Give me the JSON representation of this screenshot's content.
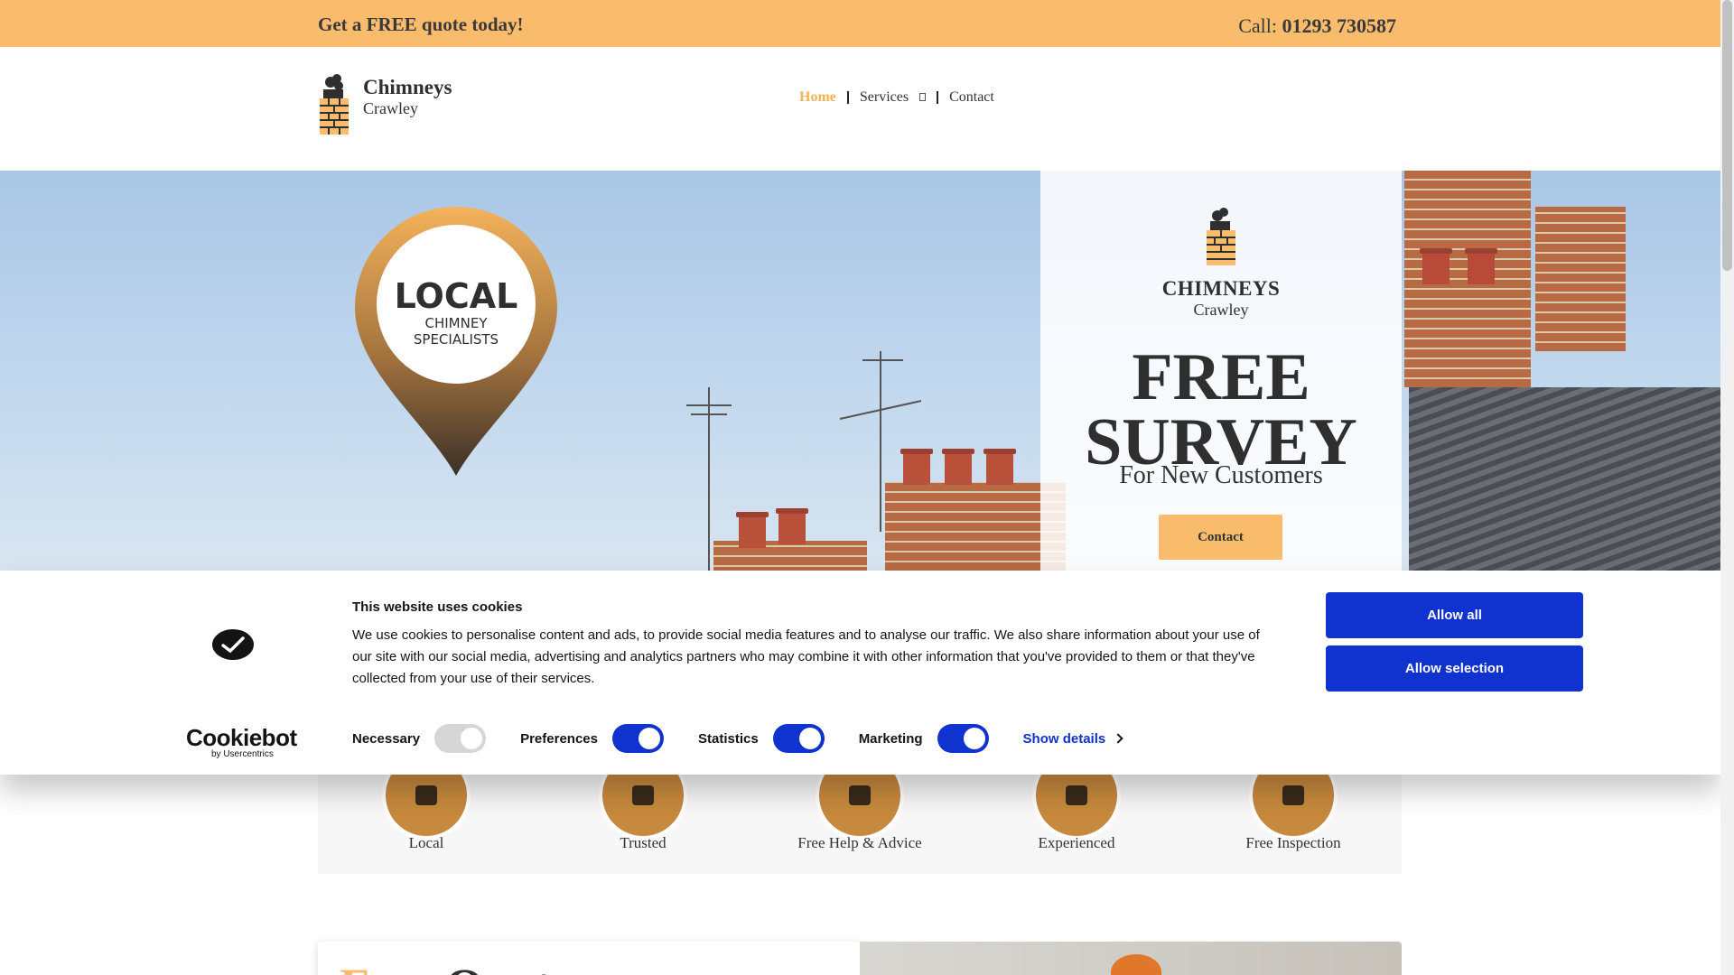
{
  "topbar": {
    "quote": "Get a FREE quote today!",
    "call_label": "Call:",
    "phone": "01293 730587"
  },
  "brand": {
    "name": "Chimneys",
    "town": "Crawley"
  },
  "nav": {
    "items": [
      {
        "label": "Home",
        "active": true
      },
      {
        "label": "Services",
        "has_dropdown": true
      },
      {
        "label": "Contact"
      }
    ]
  },
  "hero": {
    "pin_line1": "LOCAL",
    "pin_line2": "CHIMNEY",
    "pin_line3": "SPECIALISTS",
    "panel_name": "CHIMNEYS",
    "panel_town": "Crawley",
    "headline_1": "FREE",
    "headline_2": "SURVEY",
    "subline": "For New Customers",
    "cta": "Contact"
  },
  "features": [
    {
      "label": "Local"
    },
    {
      "label": "Trusted"
    },
    {
      "label": "Free Help & Advice"
    },
    {
      "label": "Experienced"
    },
    {
      "label": "Free Inspection"
    }
  ],
  "bottom": {
    "title_accent": "F",
    "title_rest": "ree Quot"
  },
  "cookie": {
    "brand_name": "Cookiebot",
    "brand_by": "by Usercentrics",
    "heading": "This website uses cookies",
    "body": "We use cookies to personalise content and ads, to provide social media features and to analyse our traffic. We also share information about your use of our site with our social media, advertising and analytics partners who may combine it with other information that you've provided to them or that they've collected from your use of their services.",
    "toggles": [
      {
        "label": "Necessary",
        "checked": true,
        "disabled": true
      },
      {
        "label": "Preferences",
        "checked": true
      },
      {
        "label": "Statistics",
        "checked": true
      },
      {
        "label": "Marketing",
        "checked": true
      }
    ],
    "show_details": "Show details",
    "allow_all": "Allow all",
    "allow_selection": "Allow selection"
  },
  "colors": {
    "accent": "#f9bc6c",
    "cookie_blue": "#1032cf"
  }
}
